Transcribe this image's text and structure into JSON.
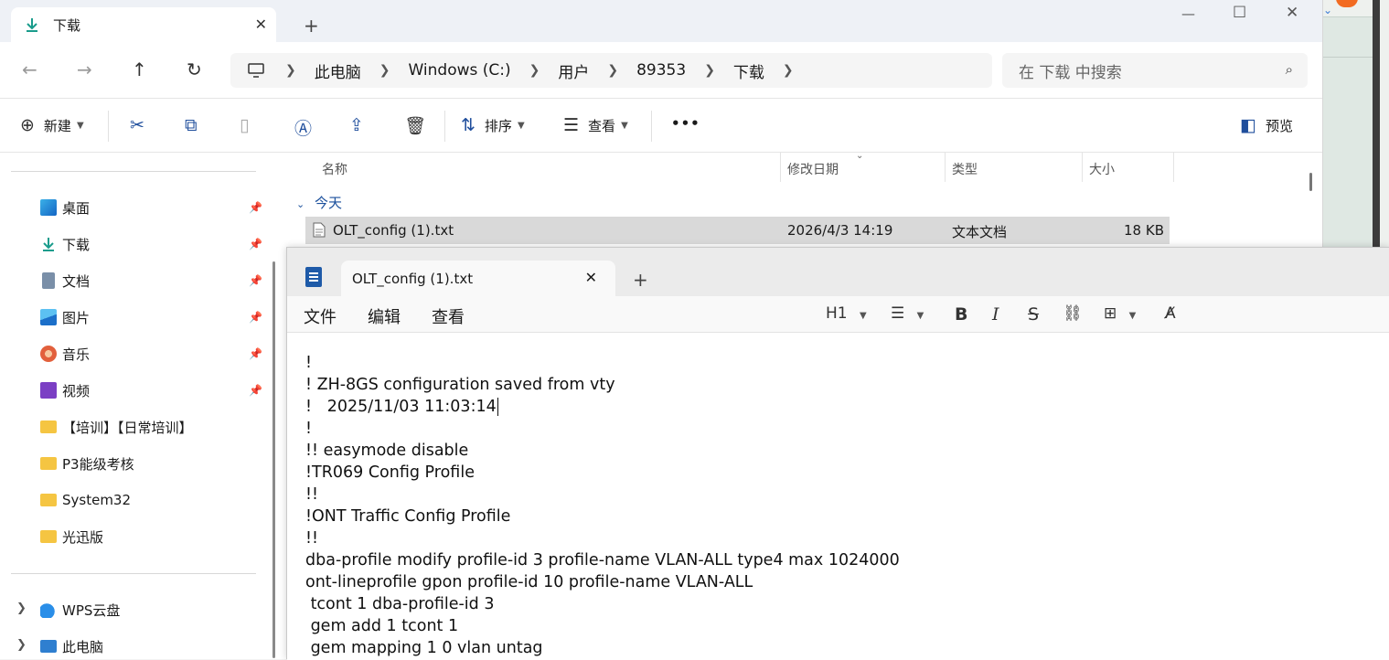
{
  "explorer": {
    "tab_title": "下载",
    "breadcrumbs": [
      "此电脑",
      "Windows (C:)",
      "用户",
      "89353",
      "下载"
    ],
    "search_placeholder": "在 下载 中搜索",
    "commands": {
      "new": "新建",
      "sort": "排序",
      "view": "查看",
      "preview": "预览",
      "more": "•••"
    },
    "sidebar": {
      "pinned": [
        {
          "label": "桌面",
          "icon": "desktop-icon"
        },
        {
          "label": "下载",
          "icon": "download-icon"
        },
        {
          "label": "文档",
          "icon": "document-icon"
        },
        {
          "label": "图片",
          "icon": "picture-icon"
        },
        {
          "label": "音乐",
          "icon": "music-icon"
        },
        {
          "label": "视频",
          "icon": "video-icon"
        }
      ],
      "folders": [
        "【培训】【日常培训】",
        "P3能级考核",
        "System32",
        "光迅版"
      ],
      "drives": [
        "WPS云盘",
        "此电脑"
      ]
    },
    "columns": [
      "名称",
      "修改日期",
      "类型",
      "大小"
    ],
    "group_label": "今天",
    "files": [
      {
        "name": "OLT_config (1).txt",
        "modified": "2026/4/3 14:19",
        "type": "文本文档",
        "size": "18 KB"
      }
    ]
  },
  "notepad": {
    "tab_title": "OLT_config (1).txt",
    "menus": [
      "文件",
      "编辑",
      "查看"
    ],
    "heading_selector": "H1",
    "lines": [
      "!",
      "! ZH-8GS configuration saved from vty",
      "!   2025/11/03 11:03:14",
      "!",
      "!! easymode disable",
      "!TR069 Config Profile",
      "!!",
      "!ONT Traffic Config Profile",
      "!!",
      "dba-profile modify profile-id 3 profile-name VLAN-ALL type4 max 1024000",
      "ont-lineprofile gpon profile-id 10 profile-name VLAN-ALL",
      " tcont 1 dba-profile-id 3",
      " gem add 1 tcont 1",
      " gem mapping 1 0 vlan untag"
    ]
  },
  "colors": {
    "accent": "#1f4e9c",
    "selected_row": "#d9d9d9",
    "folder": "#f5c542"
  }
}
